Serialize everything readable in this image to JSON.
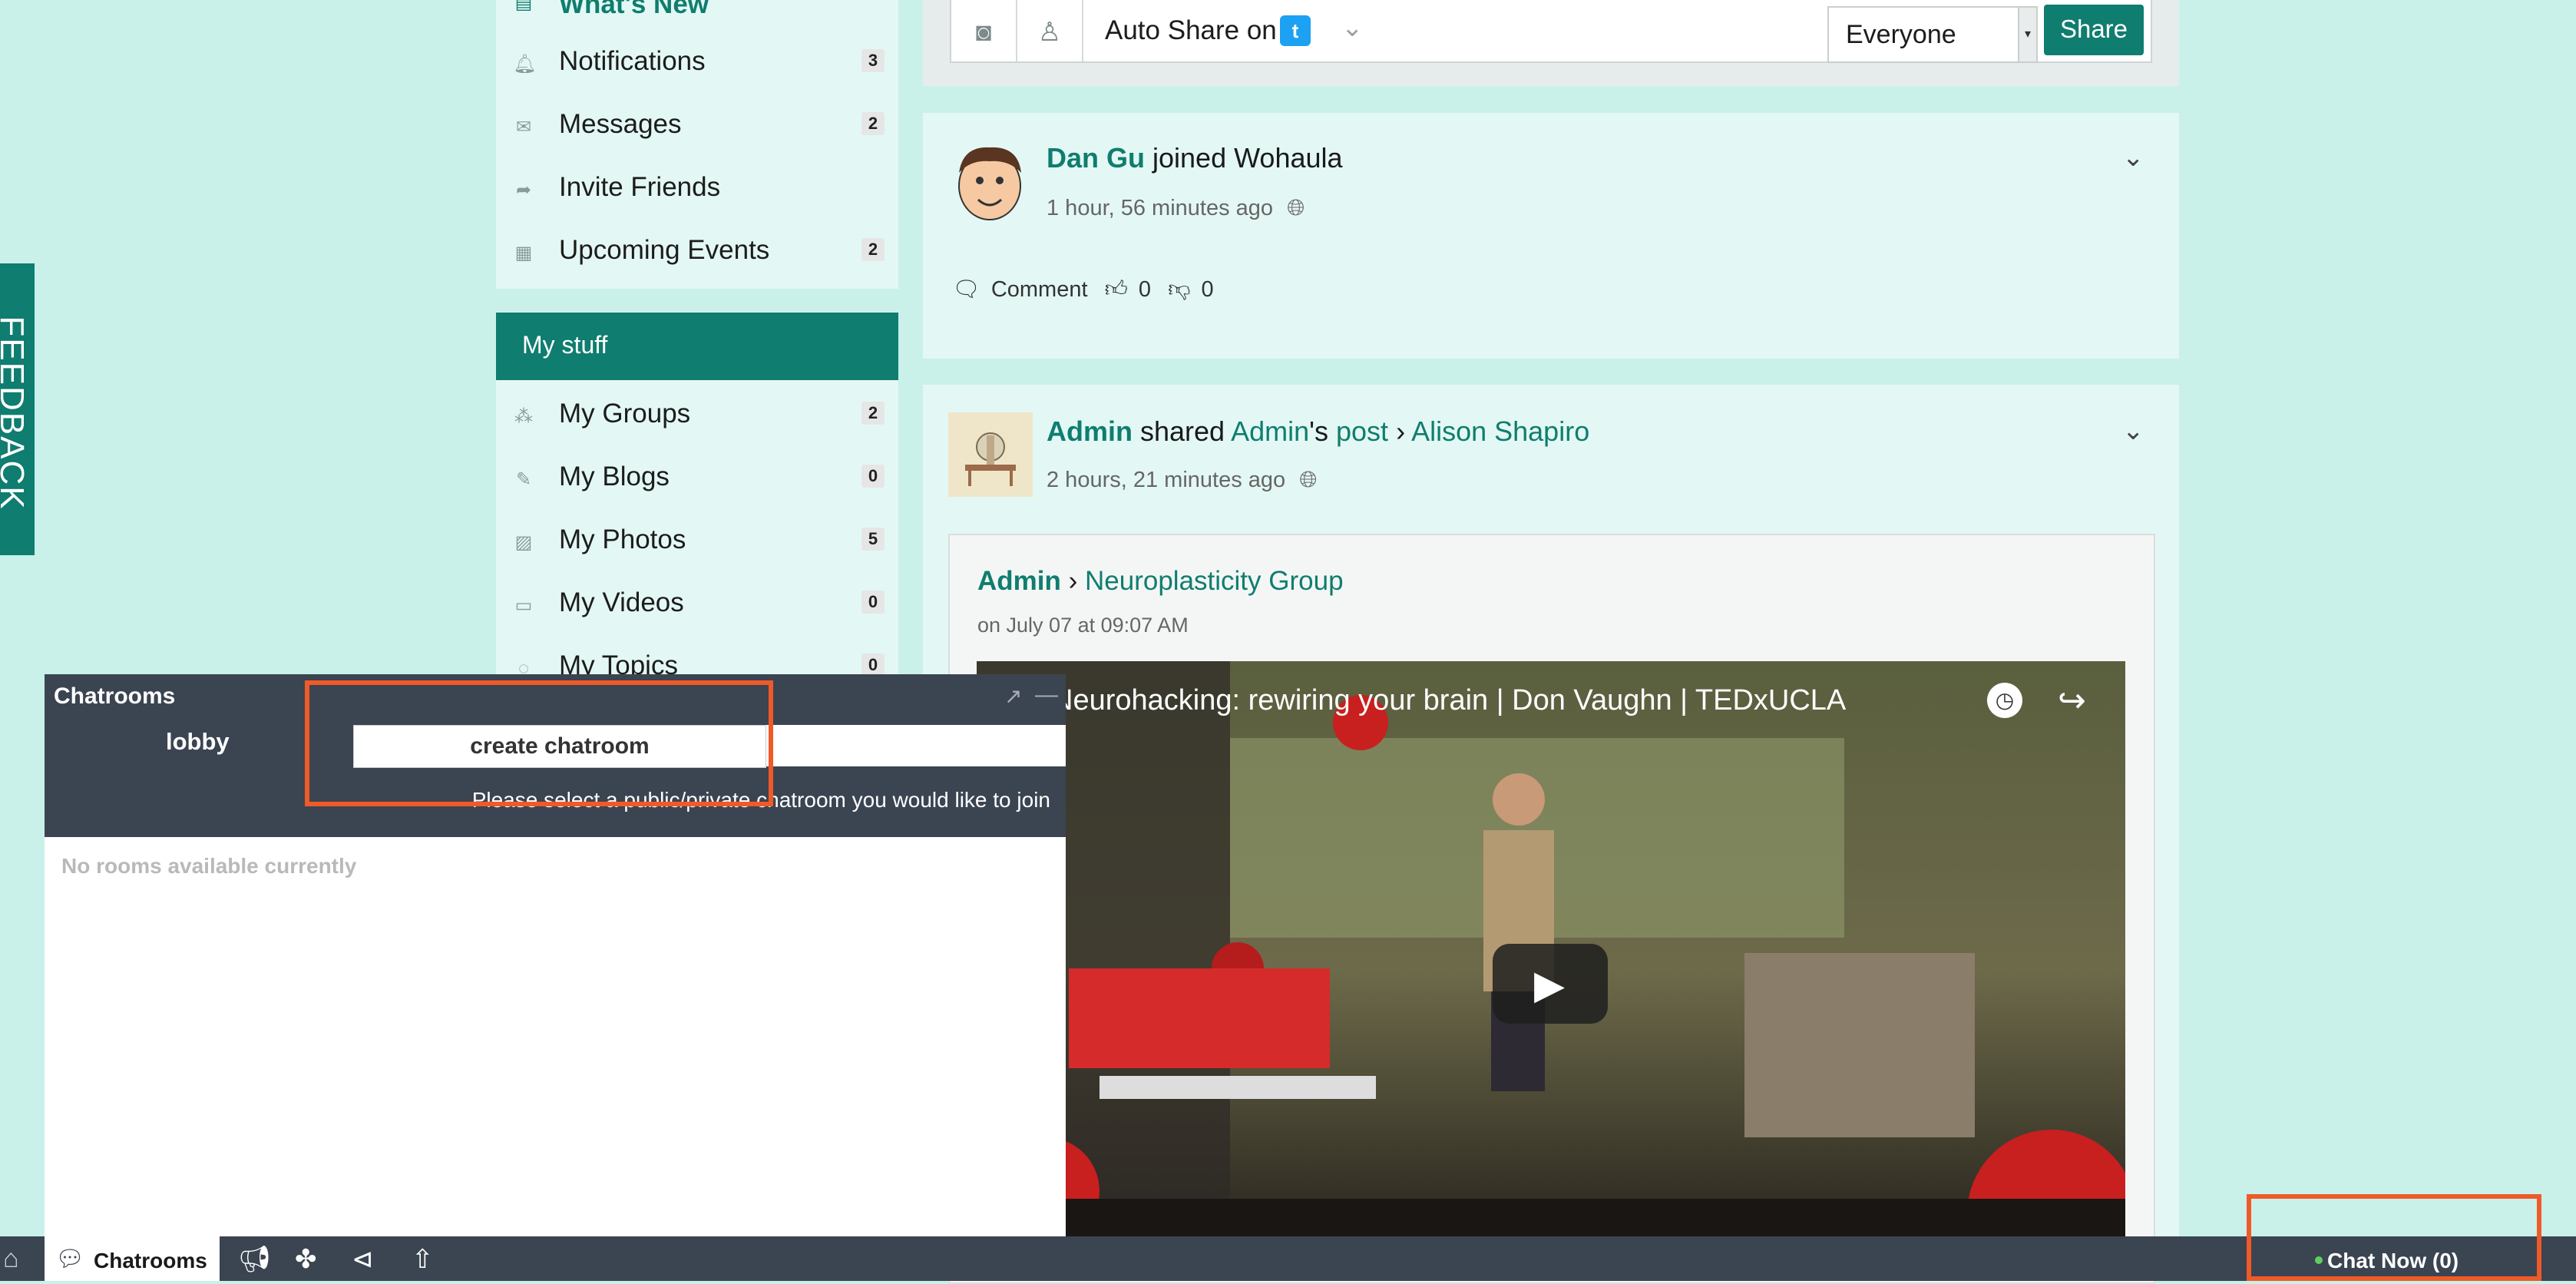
{
  "feedback_tab": {
    "label": "FEEDBACK"
  },
  "sidebar": {
    "whats_new": "What's New",
    "main_items": [
      {
        "label": "Notifications",
        "count": "3",
        "icon": "bell-icon"
      },
      {
        "label": "Messages",
        "count": "2",
        "icon": "envelope-icon"
      },
      {
        "label": "Invite Friends",
        "count": "",
        "icon": "share-arrow-icon"
      },
      {
        "label": "Upcoming Events",
        "count": "2",
        "icon": "calendar-icon"
      }
    ],
    "my_stuff_header": "My stuff",
    "stuff_items": [
      {
        "label": "My Groups",
        "count": "2",
        "icon": "groups-icon"
      },
      {
        "label": "My Blogs",
        "count": "0",
        "icon": "pencil-icon"
      },
      {
        "label": "My Photos",
        "count": "5",
        "icon": "photo-icon"
      },
      {
        "label": "My Videos",
        "count": "0",
        "icon": "video-camera-icon"
      },
      {
        "label": "My Topics",
        "count": "0",
        "icon": "topics-icon"
      }
    ]
  },
  "share_bar": {
    "auto_share": "Auto Share on",
    "privacy_value": "Everyone",
    "share_button": "Share"
  },
  "feed": {
    "post1": {
      "user": "Dan Gu",
      "action": " joined Wohaula",
      "time": "1 hour, 56 minutes ago",
      "comment": "Comment",
      "likes": "0",
      "dislikes": "0"
    },
    "post2": {
      "user": "Admin",
      "shared": " shared ",
      "owner": "Admin",
      "possessive": "'s ",
      "post_link": "post",
      "separator": " › ",
      "target": "Alison Shapiro",
      "time": "2 hours, 21 minutes ago",
      "inner_author": "Admin",
      "inner_separator": " › ",
      "inner_group": "Neuroplasticity Group",
      "inner_date": "on July 07 at 09:07 AM",
      "video_title": "Neurohacking: rewiring your brain | Don Vaughn | TEDxUCLA"
    }
  },
  "chat": {
    "title": "Chatrooms",
    "tab_lobby": "lobby",
    "create_button": "create chatroom",
    "hint": "Please select a public/private chatroom you would like to join",
    "empty": "No rooms available currently"
  },
  "bottom_bar": {
    "chatrooms": "Chatrooms",
    "chat_now": "Chat Now (0)"
  },
  "colors": {
    "accent": "#0f7d6f",
    "page_background": "#c9f1ea",
    "chat_dark": "#3b4451",
    "highlight": "#f05a28"
  }
}
